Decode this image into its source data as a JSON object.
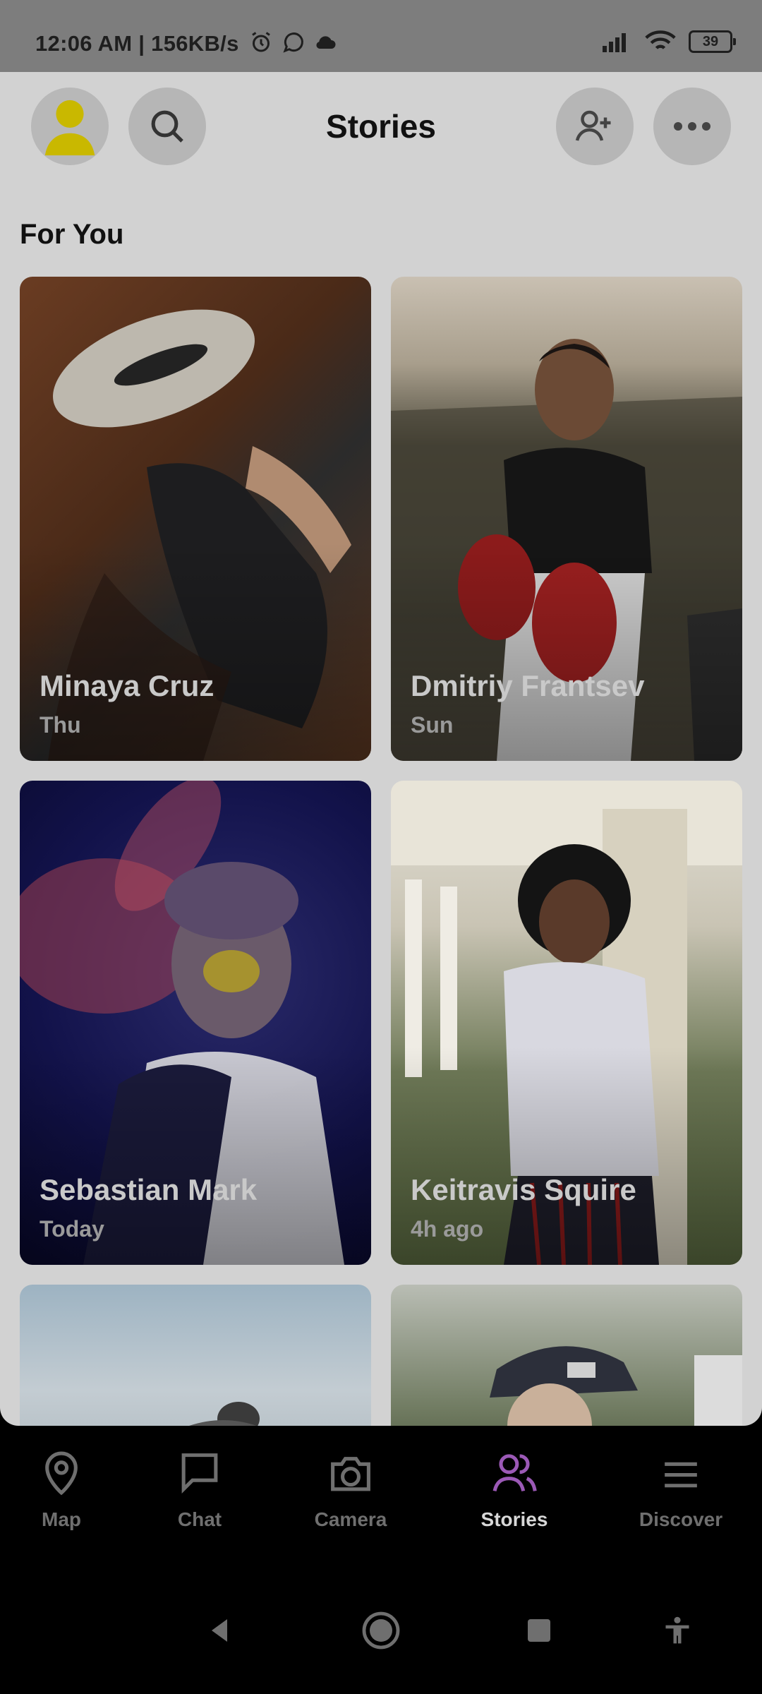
{
  "status_bar": {
    "time": "12:06 AM | 156KB/s",
    "battery": "39"
  },
  "header": {
    "title": "Stories"
  },
  "section": {
    "title": "For You"
  },
  "stories": [
    {
      "name": "Minaya Cruz",
      "time": "Thu"
    },
    {
      "name": "Dmitriy Frantsev",
      "time": "Sun"
    },
    {
      "name": "Sebastian Mark",
      "time": "Today"
    },
    {
      "name": "Keitravis Squire",
      "time": "4h ago"
    }
  ],
  "nav": [
    {
      "label": "Map",
      "icon": "map-pin-icon"
    },
    {
      "label": "Chat",
      "icon": "chat-icon"
    },
    {
      "label": "Camera",
      "icon": "camera-icon"
    },
    {
      "label": "Stories",
      "icon": "friends-icon",
      "active": true
    },
    {
      "label": "Discover",
      "icon": "menu-icon"
    }
  ],
  "colors": {
    "accent": "#9b59b6",
    "avatar": "#c9b800"
  }
}
